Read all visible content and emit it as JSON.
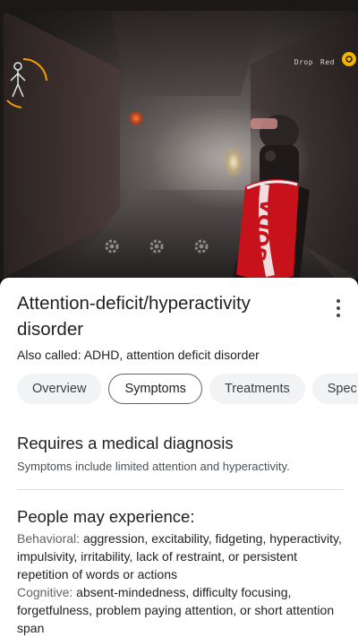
{
  "game_hud": {
    "hint_label": "Drop",
    "hint_key": "Red",
    "can_text": "SODA",
    "colors": {
      "can_red": "#c8121b",
      "badge_yellow": "#f2b400"
    }
  },
  "panel": {
    "title": "Attention-deficit/hyperactivity disorder",
    "alias": "Also called: ADHD, attention deficit disorder",
    "tabs": [
      {
        "label": "Overview",
        "active": false
      },
      {
        "label": "Symptoms",
        "active": true
      },
      {
        "label": "Treatments",
        "active": false
      },
      {
        "label": "Spec",
        "active": false
      }
    ],
    "section1": {
      "title": "Requires a medical diagnosis",
      "subtitle": "Symptoms include limited attention and hyperactivity."
    },
    "section2": {
      "title": "People may experience:",
      "behavioral_label": "Behavioral:",
      "behavioral_text": "aggression, excitability, fidgeting, hyperactivity, impulsivity, irritability, lack of restraint, or persistent repetition of words or actions",
      "cognitive_label": "Cognitive:",
      "cognitive_text": "absent-mindedness, difficulty focusing, forgetfulness, problem paying attention, or short attention span"
    }
  }
}
